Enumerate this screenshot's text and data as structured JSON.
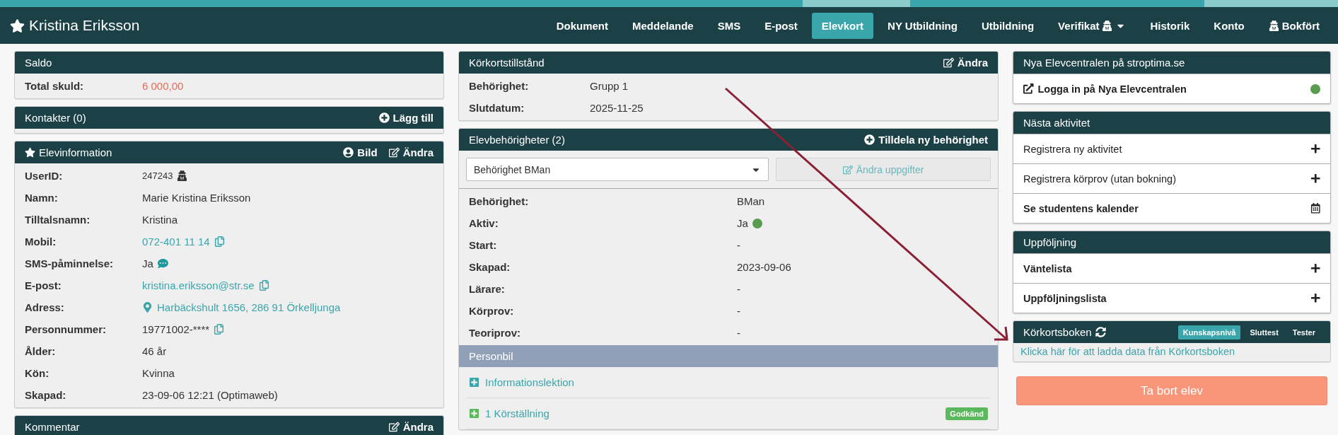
{
  "header": {
    "title": "Kristina Eriksson"
  },
  "nav": [
    {
      "label": "Dokument",
      "selected": false
    },
    {
      "label": "Meddelande",
      "selected": false
    },
    {
      "label": "SMS",
      "selected": false
    },
    {
      "label": "E-post",
      "selected": false
    },
    {
      "label": "Elevkort",
      "selected": true
    },
    {
      "label": "NY Utbildning",
      "selected": false
    },
    {
      "label": "Utbildning",
      "selected": false
    },
    {
      "label": "Verifikat",
      "selected": false,
      "icon_after": true,
      "dropdown": true
    },
    {
      "label": "Historik",
      "selected": false
    },
    {
      "label": "Konto",
      "selected": false
    },
    {
      "label": "Bokfört",
      "selected": false,
      "icon_before": true
    }
  ],
  "left": [
    {
      "title": "Saldo",
      "rows": [
        {
          "label": "Total skuld:",
          "value": "6 000,00",
          "kind": "debt"
        }
      ]
    },
    {
      "title": "Kontakter (0)",
      "actions": [
        {
          "label": "Lägg till",
          "kind": "add"
        }
      ]
    },
    {
      "title": "Elevinformation",
      "starred": true,
      "actions": [
        {
          "label": "Bild",
          "kind": "picture"
        },
        {
          "label": "Ändra",
          "kind": "edit"
        }
      ],
      "rows": [
        {
          "label": "UserID:",
          "value": "247243",
          "kind": "id"
        },
        {
          "label": "Namn:",
          "value": "Marie Kristina Eriksson",
          "kind": "text"
        },
        {
          "label": "Tilltalsnamn:",
          "value": "Kristina",
          "kind": "text"
        },
        {
          "label": "Mobil:",
          "value": "072-401 11 14",
          "kind": "link",
          "copy": true
        },
        {
          "label": "SMS-påminnelse:",
          "value": "Ja",
          "kind": "sms"
        },
        {
          "label": "E-post:",
          "value": "kristina.eriksson@str.se",
          "kind": "link",
          "copy": true
        },
        {
          "label": "Adress:",
          "value": "Harbäckshult 1656, 286 91 Örkelljunga",
          "kind": "address"
        },
        {
          "label": "Personnummer:",
          "value": "19771002-****",
          "kind": "text",
          "copy": true
        },
        {
          "label": "Ålder:",
          "value": "46 år",
          "kind": "text"
        },
        {
          "label": "Kön:",
          "value": "Kvinna",
          "kind": "text"
        },
        {
          "label": "Skapad:",
          "value": "23-09-06 12:21 (Optimaweb)",
          "kind": "text"
        }
      ]
    },
    {
      "title": "Kommentar",
      "actions": [
        {
          "label": "Ändra",
          "kind": "edit"
        }
      ]
    }
  ],
  "license": {
    "title": "Körkortstillstånd",
    "actions": [
      {
        "label": "Ändra",
        "kind": "edit"
      }
    ],
    "rows": [
      {
        "label": "Behörighet:",
        "value": "Grupp 1",
        "kind": "text"
      },
      {
        "label": "Slutdatum:",
        "value": "2025-11-25",
        "kind": "text"
      }
    ]
  },
  "permissions": {
    "title": "Elevbehörigheter (2)",
    "actions": [
      {
        "label": "Tilldela ny behörighet",
        "kind": "add"
      }
    ],
    "select": {
      "value": "Behörighet BMan"
    },
    "edit_button": {
      "label": "Ändra uppgifter",
      "disabled": true
    },
    "rows": [
      {
        "label": "Behörighet:",
        "value": "BMan",
        "kind": "text"
      },
      {
        "label": "Aktiv:",
        "value": "Ja",
        "kind": "status",
        "color": "#5b9b4f"
      },
      {
        "label": "Start:",
        "value": "-",
        "kind": "text"
      },
      {
        "label": "Skapad:",
        "value": "2023-09-06",
        "kind": "text"
      },
      {
        "label": "Lärare:",
        "value": "-",
        "kind": "text"
      },
      {
        "label": "Körprov:",
        "value": "-",
        "kind": "text"
      },
      {
        "label": "Teoriprov:",
        "value": "-",
        "kind": "text"
      }
    ],
    "section": "Personbil",
    "items": [
      {
        "label": "Informationslektion",
        "expanded": false
      },
      {
        "label": "1 Körställning",
        "expanded": false,
        "badge": "Godkänd"
      }
    ]
  },
  "right": [
    {
      "title": "Nya Elevcentralen på stroptima.se",
      "rows": [
        {
          "label": "Logga in på Nya Elevcentralen",
          "bold": true,
          "kind": "external",
          "color": "#5b9b4f"
        }
      ]
    },
    {
      "title": "Nästa aktivitet",
      "rows": [
        {
          "label": "Registrera ny aktivitet",
          "bold": false,
          "kind": "add"
        },
        {
          "label": "Registrera körprov (utan bokning)",
          "bold": false,
          "kind": "add"
        },
        {
          "label": "Se studentens kalender",
          "bold": true,
          "kind": "calendar"
        }
      ]
    },
    {
      "title": "Uppföljning",
      "rows": [
        {
          "label": "Väntelista",
          "bold": true,
          "kind": "add"
        },
        {
          "label": "Uppföljningslista",
          "bold": true,
          "kind": "add"
        }
      ]
    }
  ],
  "book": {
    "title": "Körkortsboken",
    "tabs": [
      {
        "label": "Kunskapsnivå",
        "selected": true
      },
      {
        "label": "Sluttest",
        "selected": false
      },
      {
        "label": "Tester",
        "selected": false
      }
    ],
    "link": "Klicka här för att ladda data från Körkortsboken"
  },
  "delete_button": {
    "label": "Ta bort elev"
  }
}
